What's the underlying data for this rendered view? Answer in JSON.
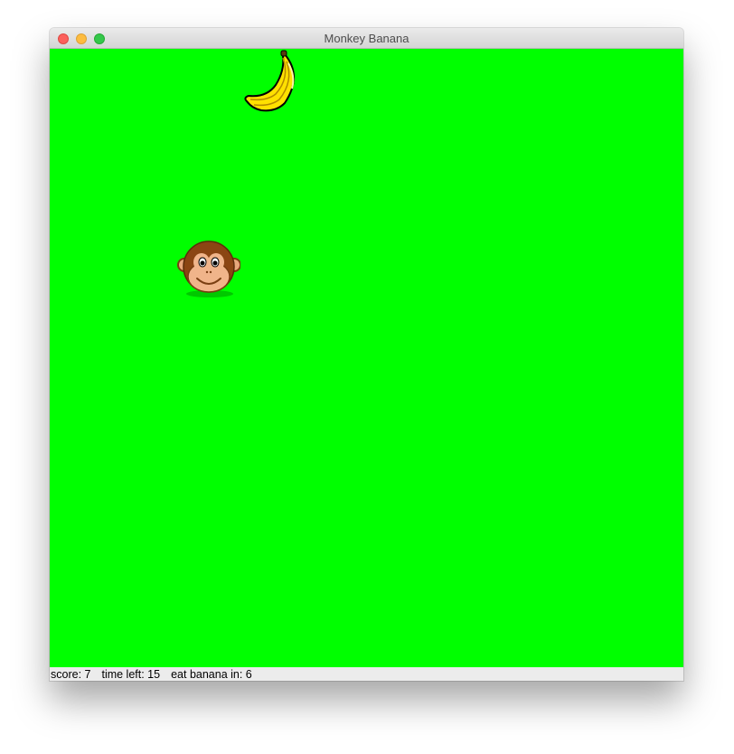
{
  "window": {
    "title": "Monkey Banana"
  },
  "game": {
    "background_color": "#00ff00",
    "sprites": [
      {
        "name": "banana",
        "icon": "banana-icon"
      },
      {
        "name": "monkey",
        "icon": "monkey-face-icon"
      }
    ]
  },
  "status": {
    "score_label": "score: 7",
    "time_label": "time left: 15",
    "eat_label": "eat banana in: 6"
  }
}
